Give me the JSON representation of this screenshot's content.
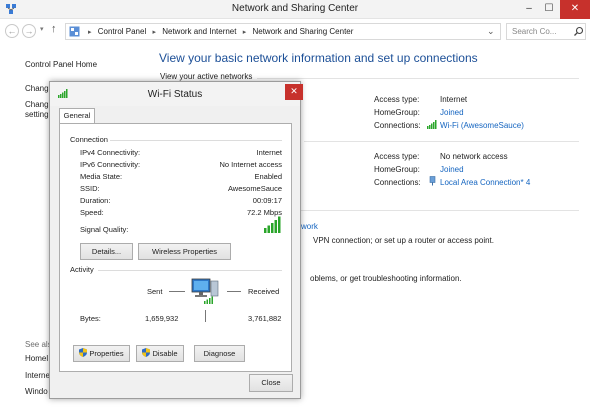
{
  "window": {
    "title": "Network and Sharing Center",
    "min_label": "–",
    "max_label": "☐",
    "close_label": "✕"
  },
  "address_bar": {
    "back_icon": "back-arrow-icon",
    "forward_icon": "forward-arrow-icon",
    "crumbs": [
      "Control Panel",
      "Network and Internet",
      "Network and Sharing Center"
    ],
    "search_placeholder": "Search Co..."
  },
  "left_nav": {
    "home": "Control Panel Home",
    "partial1": "Chang",
    "partial2": "Chang",
    "partial3": "setting",
    "see_also_label": "See als",
    "see_also_items": [
      "Homel",
      "Interne",
      "Windo"
    ]
  },
  "main": {
    "heading": "View your basic network information and set up connections",
    "active_label": "View your active networks",
    "net1": {
      "access_label": "Access type:",
      "access_value": "Internet",
      "homegroup_label": "HomeGroup:",
      "homegroup_value": "Joined",
      "connections_label": "Connections:",
      "connections_value": "Wi-Fi (AwesomeSauce)"
    },
    "net2": {
      "access_label": "Access type:",
      "access_value": "No network access",
      "homegroup_label": "HomeGroup:",
      "homegroup_value": "Joined",
      "connections_label": "Connections:",
      "connections_value": "Local Area Connection* 4"
    },
    "change_partial_link": "work",
    "change_partial_text": "VPN connection; or set up a router or access point.",
    "trouble_partial_text": "oblems, or get troubleshooting information."
  },
  "dialog": {
    "title": "Wi-Fi Status",
    "close_label": "✕",
    "tab": "General",
    "connection_group": "Connection",
    "rows": [
      {
        "label": "IPv4 Connectivity:",
        "value": "Internet"
      },
      {
        "label": "IPv6 Connectivity:",
        "value": "No Internet access"
      },
      {
        "label": "Media State:",
        "value": "Enabled"
      },
      {
        "label": "SSID:",
        "value": "AwesomeSauce"
      },
      {
        "label": "Duration:",
        "value": "00:09:17"
      },
      {
        "label": "Speed:",
        "value": "72.2 Mbps"
      }
    ],
    "signal_label": "Signal Quality:",
    "signal_bars": 5,
    "details_button": "Details...",
    "wireless_button": "Wireless Properties",
    "activity_group": "Activity",
    "sent_label": "Sent",
    "received_label": "Received",
    "bytes_label": "Bytes:",
    "bytes_sent": "1,659,932",
    "bytes_received": "3,761,882",
    "properties_button": "Properties",
    "disable_button": "Disable",
    "diagnose_button": "Diagnose",
    "close_button": "Close"
  },
  "colors": {
    "link": "#1565c0",
    "heading": "#1c4f97",
    "close_red": "#c7312c",
    "signal_green": "#2aa52a"
  }
}
